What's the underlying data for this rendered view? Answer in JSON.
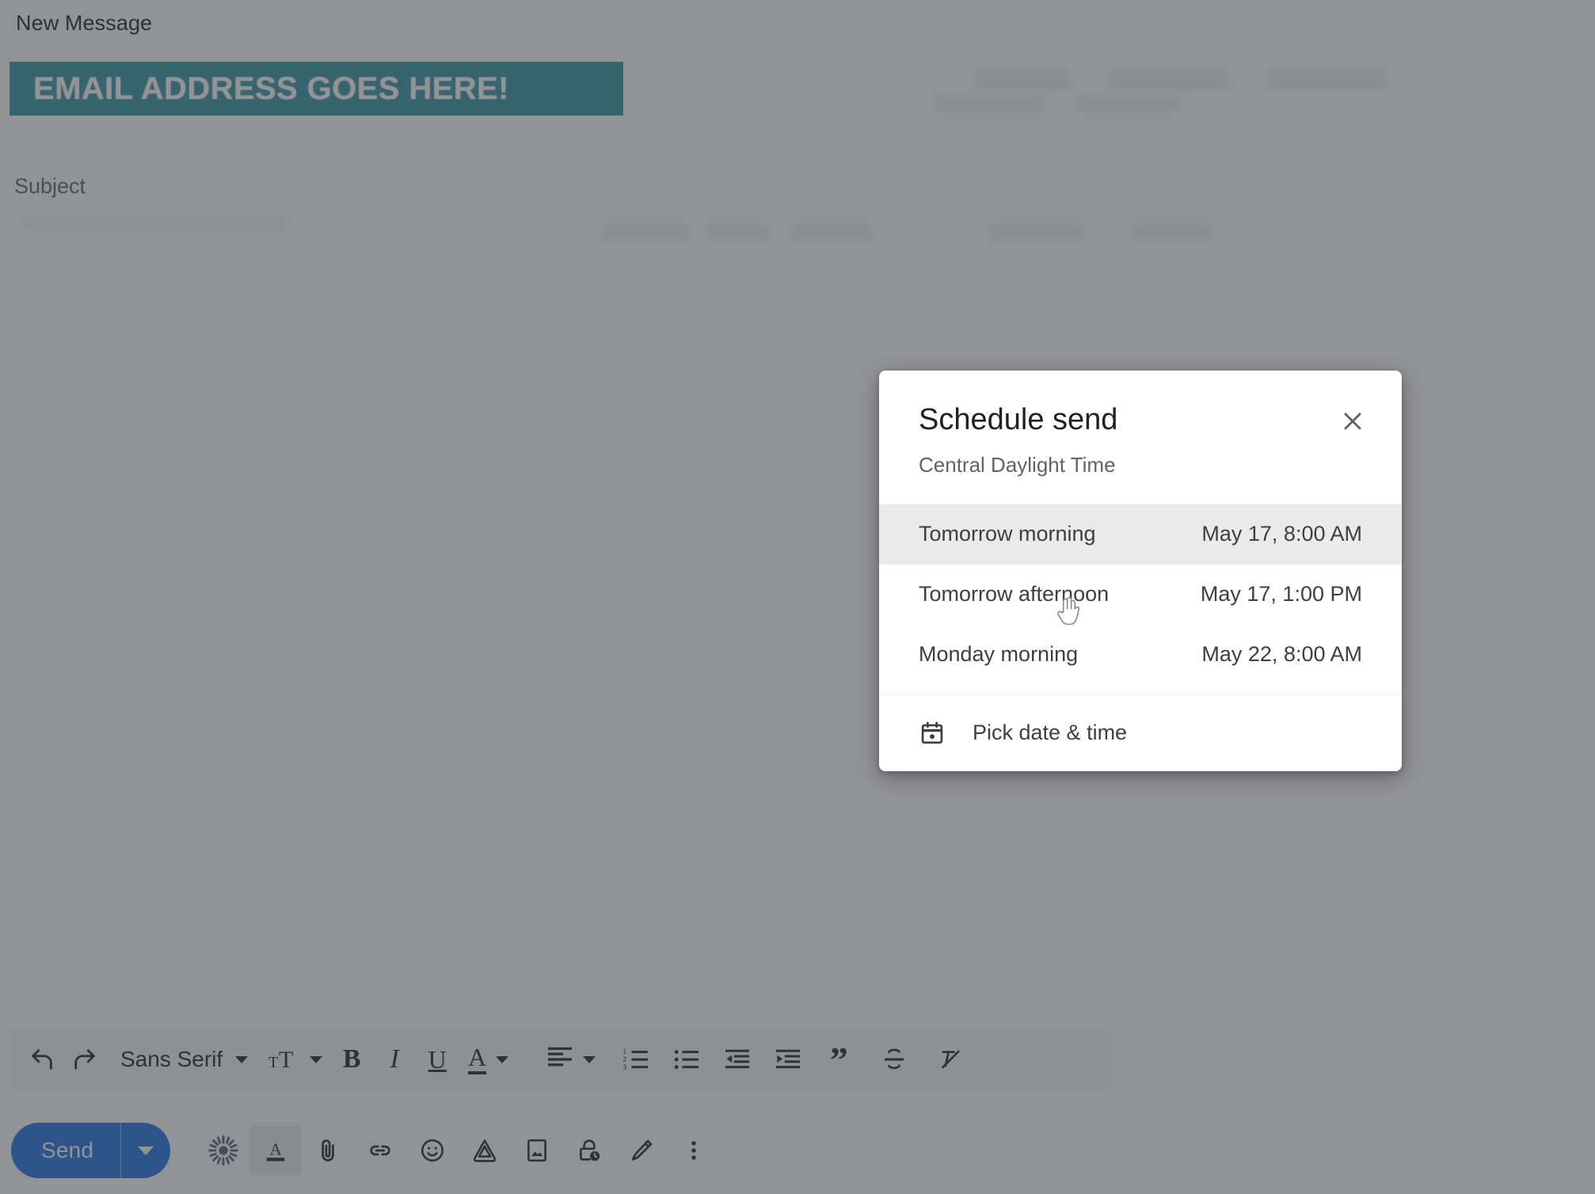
{
  "compose": {
    "window_title": "New Message",
    "recipient_banner": "EMAIL ADDRESS GOES HERE!",
    "subject_placeholder": "Subject",
    "banner_color": "#2f94a8"
  },
  "format_toolbar": {
    "undo_icon": "undo-icon",
    "redo_icon": "redo-icon",
    "font_family_value": "Sans Serif",
    "font_size_icon": "font-size-icon",
    "bold_label": "B",
    "italic_label": "I",
    "underline_label": "U",
    "text_color_label": "A",
    "align_icon": "align-left-icon",
    "numbered_list_icon": "numbered-list-icon",
    "bulleted_list_icon": "bulleted-list-icon",
    "indent_less_icon": "indent-decrease-icon",
    "indent_more_icon": "indent-increase-icon",
    "quote_label": "”",
    "strikethrough_icon": "strikethrough-icon",
    "remove_format_icon": "remove-formatting-icon"
  },
  "send_row": {
    "send_label": "Send",
    "send_options_icon": "chevron-down-icon",
    "send_button_color": "#1a73e8",
    "icons": [
      "sparkle-ai-icon",
      "text-format-icon",
      "attach-file-icon",
      "insert-link-icon",
      "emoji-icon",
      "drive-icon",
      "insert-photo-icon",
      "confidential-mode-icon",
      "signature-icon",
      "more-options-icon"
    ]
  },
  "dialog": {
    "title": "Schedule send",
    "timezone": "Central Daylight Time",
    "close_icon": "close-icon",
    "options": [
      {
        "when": "Tomorrow morning",
        "datetime": "May 17, 8:00 AM",
        "hovered": true
      },
      {
        "when": "Tomorrow afternoon",
        "datetime": "May 17, 1:00 PM",
        "hovered": false
      },
      {
        "when": "Monday morning",
        "datetime": "May 22, 8:00 AM",
        "hovered": false
      }
    ],
    "pick_label": "Pick date & time",
    "pick_icon": "calendar-icon"
  },
  "cursor": {
    "type": "pointing-hand-cursor"
  }
}
